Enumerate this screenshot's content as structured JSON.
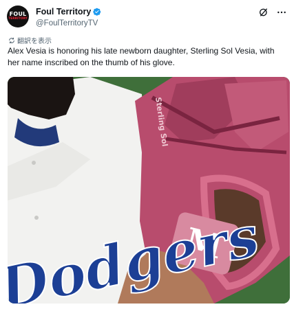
{
  "account": {
    "name": "Foul Territory",
    "handle": "@FoulTerritoryTV",
    "avatar_text_top": "FOUL",
    "avatar_text_bottom": "TERRITORY"
  },
  "translate_label": "翻訳を表示",
  "tweet_text": "Alex Vesia is honoring his late newborn daughter, Sterling Sol Vesia, with her name inscribed on the thumb of his glove.",
  "media": {
    "jersey_lettering": "Dodgers",
    "glove_inscription": "Sterling Sol",
    "glove_logo": "M"
  },
  "colors": {
    "verified_blue": "#1d9bf0",
    "glove_pink": "#b84c6d",
    "jersey_blue": "#1c3f95"
  }
}
